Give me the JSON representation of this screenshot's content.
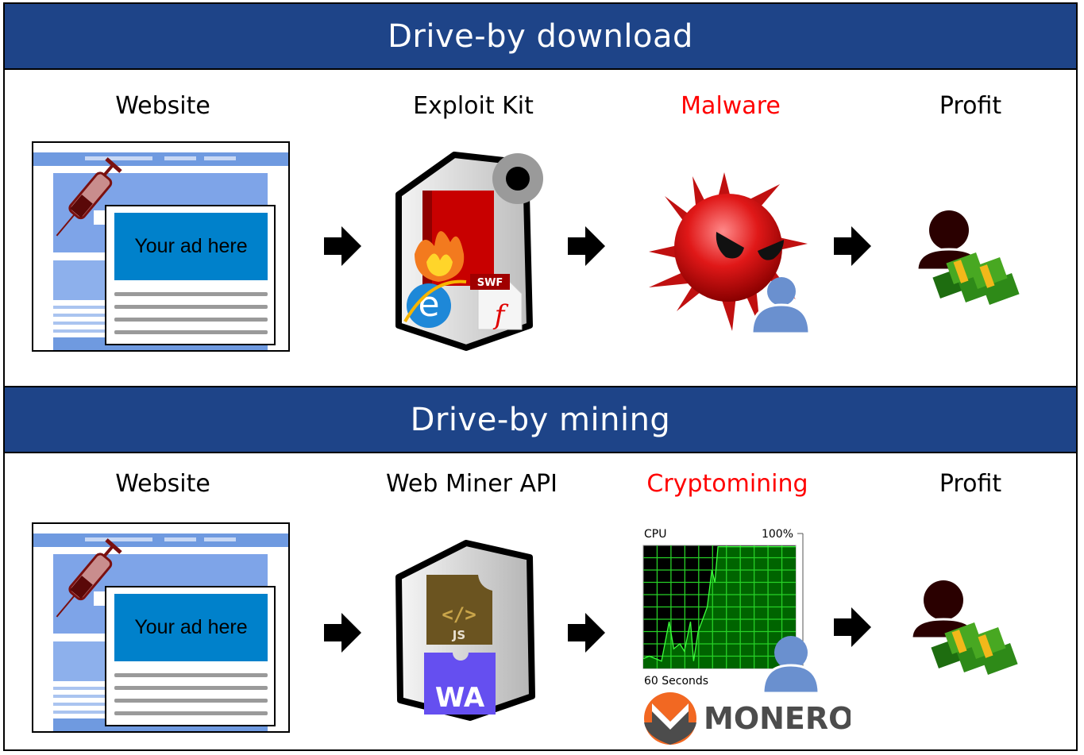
{
  "sections": [
    {
      "title": "Drive-by download",
      "stages": [
        {
          "label": "Website",
          "color": "#000000",
          "icon": "website-with-syringe-icon",
          "ad_text": "Your ad here"
        },
        {
          "label": "Exploit Kit",
          "color": "#000000",
          "icon": "exploit-kit-server-icon",
          "badge_text": "SWF"
        },
        {
          "label": "Malware",
          "color": "#ff0000",
          "icon": "malware-virus-icon"
        },
        {
          "label": "Profit",
          "color": "#000000",
          "icon": "user-with-money-icon"
        }
      ]
    },
    {
      "title": "Drive-by mining",
      "stages": [
        {
          "label": "Website",
          "color": "#000000",
          "icon": "website-with-syringe-icon",
          "ad_text": "Your ad here"
        },
        {
          "label": "Web Miner API",
          "color": "#000000",
          "icon": "web-miner-server-icon",
          "js_text": "JS",
          "wa_text": "WA",
          "code_text": "</>"
        },
        {
          "label": "Cryptomining",
          "color": "#ff0000",
          "icon": "cpu-usage-graph-icon",
          "cpu_label": "CPU",
          "cpu_max": "100%",
          "cpu_time": "60 Seconds",
          "coin_name": "MONERO"
        },
        {
          "label": "Profit",
          "color": "#000000",
          "icon": "user-with-money-icon"
        }
      ]
    }
  ],
  "colors": {
    "banner": "#1e4488",
    "highlight": "#ff0000",
    "ad": "#0081cb",
    "user": "#6a90cf",
    "monero_orange": "#f26822",
    "webassembly": "#654ff0",
    "js_badge": "#6b5420"
  }
}
